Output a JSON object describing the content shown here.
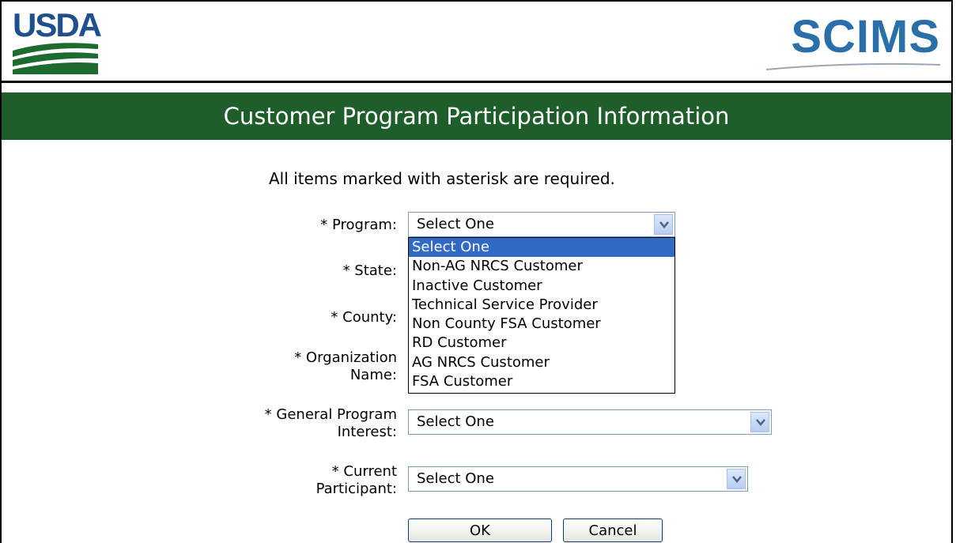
{
  "header": {
    "usda_logo_text": "USDA",
    "scims_logo_text": "SCIMS",
    "banner_title": "Customer Program Participation Information"
  },
  "form": {
    "required_note": "All items marked with asterisk are required.",
    "program_label": "* Program:",
    "program_value": "Select One",
    "state_label": "* State:",
    "county_label": "* County:",
    "org_label_line1": "* Organization",
    "org_label_line2": "Name:",
    "general_label_line1": "* General Program",
    "general_label_line2": "Interest:",
    "general_value": "Select One",
    "current_label_line1": "* Current",
    "current_label_line2": "Participant:",
    "current_value": "Select One",
    "ok_label": "OK",
    "cancel_label": "Cancel"
  },
  "program_options": [
    "Select One",
    "Non-AG NRCS Customer",
    "Inactive Customer",
    "Technical Service Provider",
    "Non County FSA Customer",
    "RD Customer",
    "AG NRCS Customer",
    "FSA Customer"
  ],
  "colors": {
    "banner_green": "#1d5e2a",
    "usda_blue": "#1f4f8f",
    "scims_blue": "#2a6fa8",
    "selection_blue": "#316ac5"
  }
}
